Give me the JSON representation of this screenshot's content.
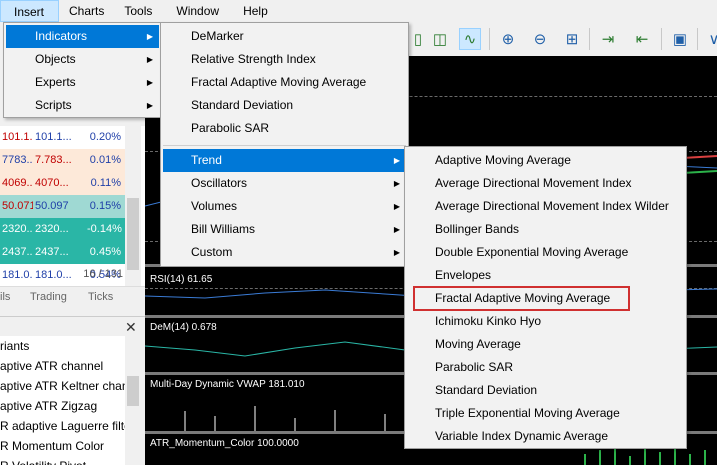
{
  "menubar": {
    "items": [
      {
        "label": "Insert",
        "active": true
      },
      {
        "label": "Charts",
        "active": false
      },
      {
        "label": "Tools",
        "active": false
      },
      {
        "label": "Window",
        "active": false
      },
      {
        "label": "Help",
        "active": false
      }
    ]
  },
  "toolbar": {
    "icons": [
      "candlestick-icon",
      "line-chart-icon",
      "zoom-in-icon",
      "zoom-out-icon",
      "grid-icon",
      "autoscroll-icon",
      "chart-shift-icon",
      "screenshot-icon"
    ]
  },
  "insert_menu": {
    "items": [
      {
        "label": "Indicators",
        "has_submenu": true,
        "highlighted": true
      },
      {
        "label": "Objects",
        "has_submenu": true,
        "highlighted": false
      },
      {
        "label": "Experts",
        "has_submenu": true,
        "highlighted": false
      },
      {
        "label": "Scripts",
        "has_submenu": true,
        "highlighted": false
      }
    ]
  },
  "indicators_menu": {
    "top_items": [
      "DeMarker",
      "Relative Strength Index",
      "Fractal Adaptive Moving Average",
      "Standard Deviation",
      "Parabolic SAR"
    ],
    "group_items": [
      {
        "label": "Trend",
        "highlighted": true
      },
      {
        "label": "Oscillators",
        "highlighted": false
      },
      {
        "label": "Volumes",
        "highlighted": false
      },
      {
        "label": "Bill Williams",
        "highlighted": false
      },
      {
        "label": "Custom",
        "highlighted": false
      }
    ]
  },
  "trend_menu": {
    "items": [
      "Adaptive Moving Average",
      "Average Directional Movement Index",
      "Average Directional Movement Index Wilder",
      "Bollinger Bands",
      "Double Exponential Moving Average",
      "Envelopes",
      "Fractal Adaptive Moving Average",
      "Ichimoku Kinko Hyo",
      "Moving Average",
      "Parabolic SAR",
      "Standard Deviation",
      "Triple Exponential Moving Average",
      "Variable Index Dynamic Average"
    ],
    "boxed_item": "Fractal Adaptive Moving Average"
  },
  "market_watch": {
    "rows": [
      {
        "bid": "101.1...",
        "ask": "101.1...",
        "change": "0.20%",
        "bg": "#ffffff",
        "bid_color": "#c00000",
        "ask_color": "#1f3fa8"
      },
      {
        "bid": "7783...",
        "ask": "7.783...",
        "change": "0.01%",
        "bg": "#fde9d9",
        "bid_color": "#1f3fa8",
        "ask_color": "#c00000"
      },
      {
        "bid": "4069...",
        "ask": "4070...",
        "change": "0.11%",
        "bg": "#fde9d9",
        "bid_color": "#c00000",
        "ask_color": "#c00000"
      },
      {
        "bid": "50.071",
        "ask": "50.097",
        "change": "0.15%",
        "bg": "#9fd9d3",
        "bid_color": "#c00000",
        "ask_color": "#1f3fa8"
      },
      {
        "bid": "2320...",
        "ask": "2320...",
        "change": "-0.14%",
        "bg": "#2ab6a6",
        "bid_color": "#ffffff",
        "ask_color": "#ffffff"
      },
      {
        "bid": "2437...",
        "ask": "2437...",
        "change": "0.45%",
        "bg": "#2ab6a6",
        "bid_color": "#ffffff",
        "ask_color": "#ffffff"
      },
      {
        "bid": "181.0...",
        "ask": "181.0...",
        "change": "0.54%",
        "bg": "#ffffff",
        "bid_color": "#1f3fa8",
        "ask_color": "#1f3fa8"
      }
    ],
    "count": "16 / 131"
  },
  "bottom_tabs": [
    "ils",
    "Trading",
    "Ticks"
  ],
  "navigator": {
    "items": [
      "riants",
      "aptive ATR channel",
      "aptive ATR Keltner chan",
      "aptive ATR Zigzag",
      "R adaptive Laguerre filte",
      "R Momentum Color",
      "R Volatility Pivot"
    ]
  },
  "chart": {
    "pane_labels": [
      "RSI(14) 61.65",
      "DeM(14) 0.678",
      "Multi-Day Dynamic VWAP 181.010",
      "ATR_Momentum_Color 100.0000"
    ],
    "colors": {
      "accent": "#0078d7",
      "hover": "#cce8ff",
      "box": "#d03030"
    }
  }
}
